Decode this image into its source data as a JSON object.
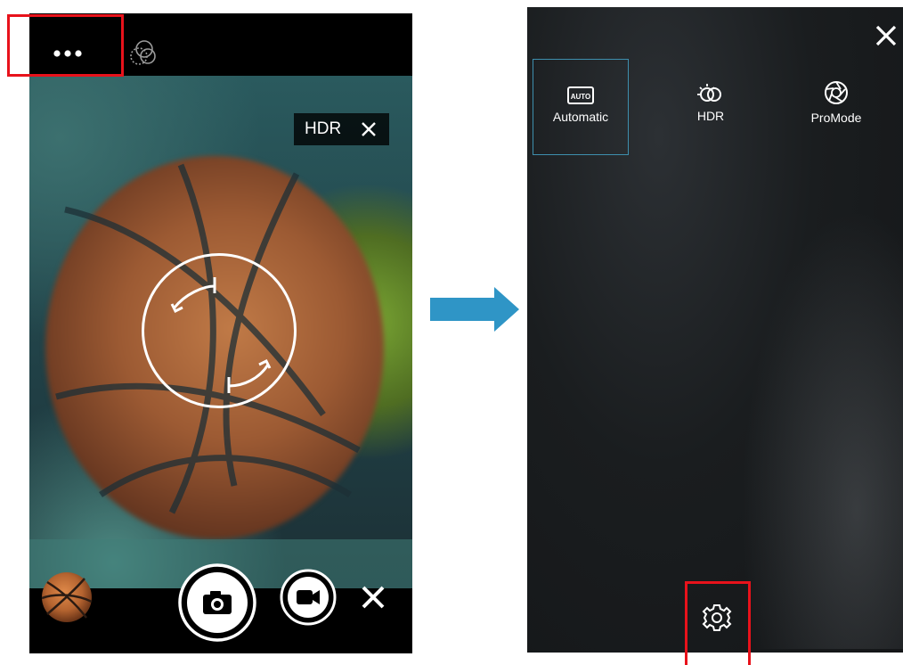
{
  "left_screen": {
    "hdr_chip": {
      "label": "HDR"
    }
  },
  "right_screen": {
    "modes": [
      {
        "label": "Automatic",
        "icon": "auto-icon",
        "selected": true
      },
      {
        "label": "HDR",
        "icon": "hdr-icon",
        "selected": false
      },
      {
        "label": "ProMode",
        "icon": "aperture-icon",
        "selected": false
      }
    ],
    "auto_badge": "AUTO"
  },
  "colors": {
    "highlight_red": "#e8121b",
    "arrow_blue": "#2f95c6",
    "selected_border": "#3e8fae"
  }
}
